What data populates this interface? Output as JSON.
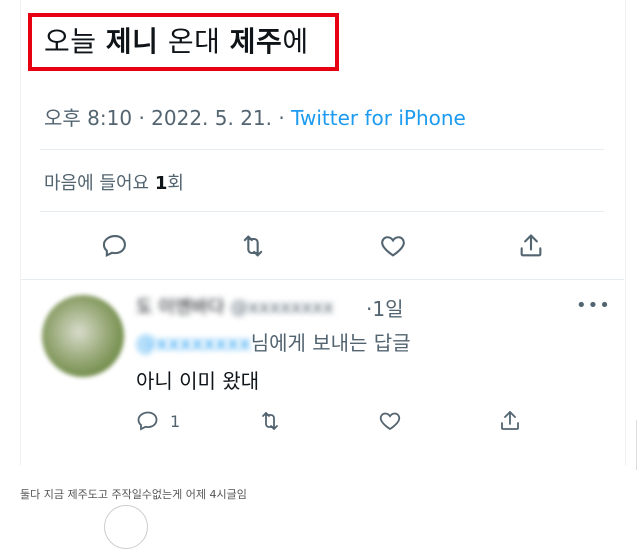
{
  "tweet": {
    "text_part1": "오늘 ",
    "text_bold1": "제니",
    "text_part2": " 온대 ",
    "text_bold2": "제주",
    "text_part3": "에",
    "time": "오후 8:10",
    "date": "2022. 5. 21.",
    "dot": "·",
    "source": "Twitter for iPhone",
    "likes_label": "마음에 들어요",
    "likes_count": "1",
    "likes_unit": "회"
  },
  "reply": {
    "name": "도 이엔바다",
    "handle": "@xxxxxxxx",
    "time": "1일",
    "more": "•••",
    "reply_to_handle": "@xxxxxxxx",
    "reply_to_suffix": "님에게 보내는 답글",
    "body": "아니 이미 왔대",
    "reply_count": "1"
  },
  "caption": "둘다 지금 제주도고 주작일수없는게 어제 4시글임",
  "colors": {
    "highlight": "#e60012",
    "link": "#1d9bf0",
    "muted": "#536471",
    "text": "#0f1419"
  },
  "icons": [
    "reply-icon",
    "retweet-icon",
    "like-icon",
    "share-icon"
  ]
}
